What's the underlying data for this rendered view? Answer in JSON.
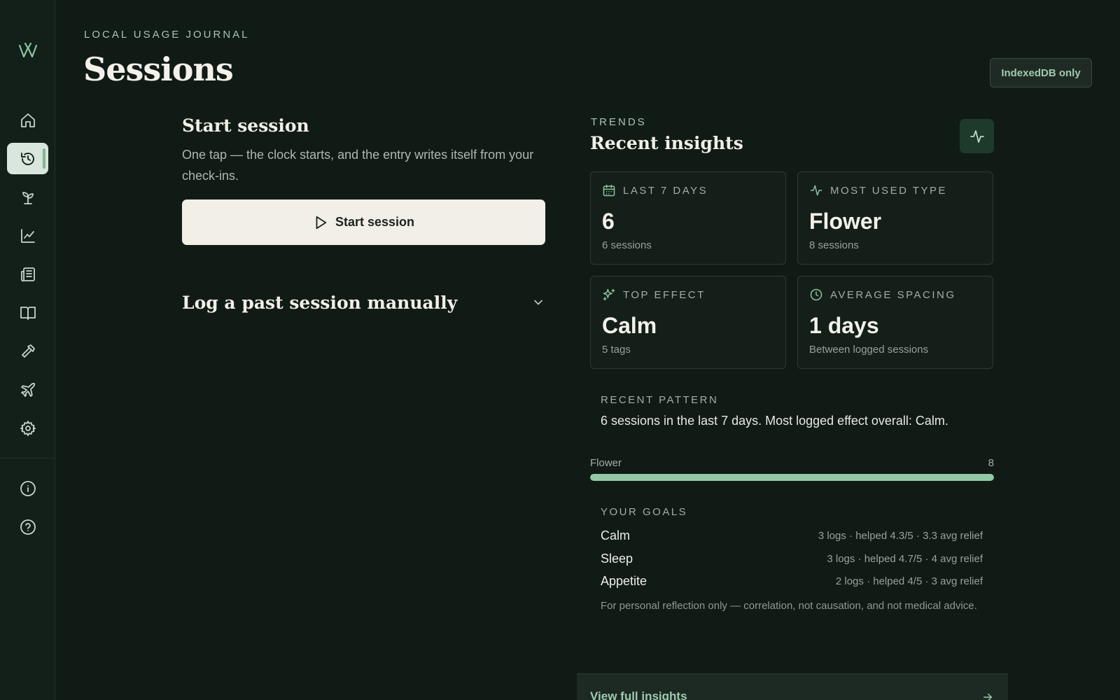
{
  "sidebar": {
    "logo": "w-logo-icon",
    "items": [
      {
        "id": "home",
        "icon": "home-icon"
      },
      {
        "id": "sessions",
        "icon": "session-clock-icon",
        "active": true
      },
      {
        "id": "plants",
        "icon": "sprout-icon"
      },
      {
        "id": "trends",
        "icon": "line-chart-icon"
      },
      {
        "id": "journal",
        "icon": "newspaper-icon"
      },
      {
        "id": "library",
        "icon": "book-open-icon"
      },
      {
        "id": "tools",
        "icon": "hammer-icon"
      },
      {
        "id": "travel",
        "icon": "plane-icon"
      },
      {
        "id": "settings",
        "icon": "gear-icon"
      }
    ],
    "bottom_items": [
      {
        "id": "about",
        "icon": "info-icon"
      },
      {
        "id": "help",
        "icon": "help-icon"
      }
    ]
  },
  "header": {
    "eyebrow": "LOCAL USAGE JOURNAL",
    "title": "Sessions",
    "badge": "IndexedDB only"
  },
  "start": {
    "title": "Start session",
    "description": "One tap — the clock starts, and the entry writes itself from your check-ins.",
    "button_label": "Start session"
  },
  "manual": {
    "title": "Log a past session manually"
  },
  "insights": {
    "eyebrow": "TRENDS",
    "title": "Recent insights",
    "cards": [
      {
        "label": "LAST 7 DAYS",
        "icon": "calendar-icon",
        "value": "6",
        "sub": "6 sessions"
      },
      {
        "label": "MOST USED TYPE",
        "icon": "activity-icon",
        "value": "Flower",
        "sub": "8 sessions"
      },
      {
        "label": "TOP EFFECT",
        "icon": "sparkles-icon",
        "value": "Calm",
        "sub": "5 tags"
      },
      {
        "label": "AVERAGE SPACING",
        "icon": "clock-icon",
        "value": "1 days",
        "sub": "Between logged sessions"
      }
    ],
    "pattern_label": "RECENT PATTERN",
    "pattern_text": "6 sessions in the last 7 days. Most logged effect overall: Calm.",
    "type_bar": {
      "label": "Flower",
      "count": "8",
      "fraction": 1.0
    },
    "goals_label": "YOUR GOALS",
    "goals": [
      {
        "name": "Calm",
        "stats": "3 logs · helped 4.3/5 · 3.3 avg relief"
      },
      {
        "name": "Sleep",
        "stats": "3 logs · helped 4.7/5 · 4 avg relief"
      },
      {
        "name": "Appetite",
        "stats": "2 logs · helped 4/5 · 3 avg relief"
      }
    ],
    "disclaimer": "For personal reflection only — correlation, not causation, and not medical advice.",
    "view_all_label": "View full insights"
  },
  "colors": {
    "background": "#111b16",
    "accent": "#92c9a4",
    "button_light": "#f2efe6"
  }
}
